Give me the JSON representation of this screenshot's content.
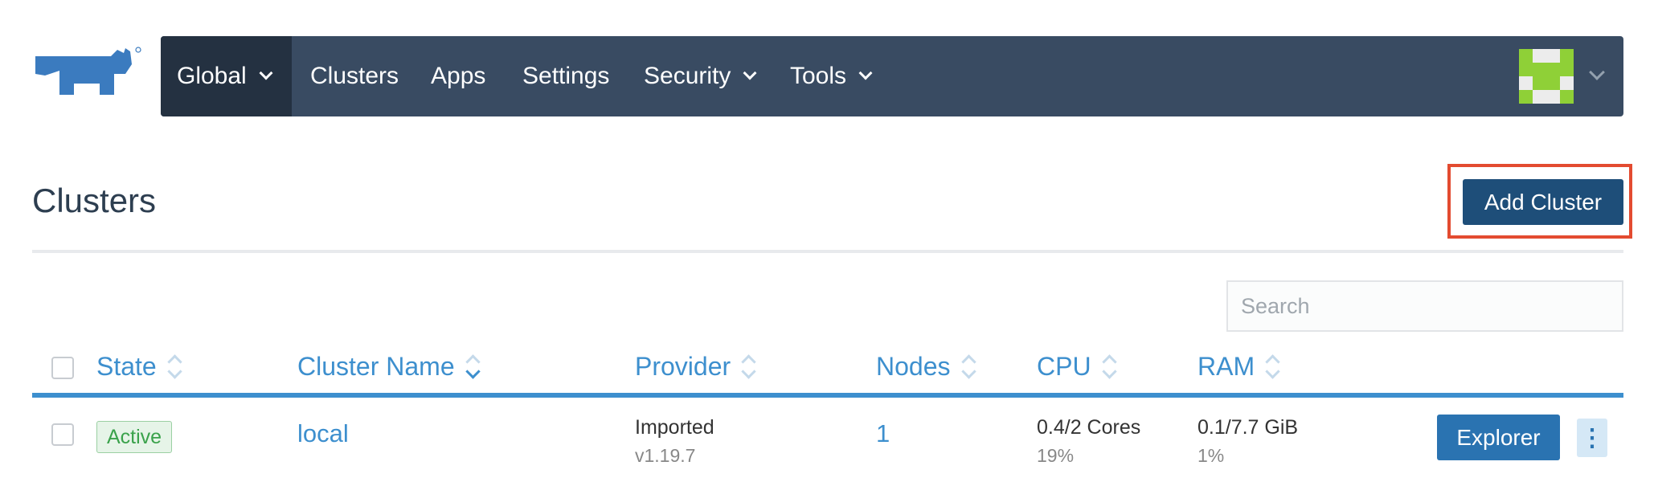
{
  "nav": {
    "global": "Global",
    "clusters": "Clusters",
    "apps": "Apps",
    "settings": "Settings",
    "security": "Security",
    "tools": "Tools"
  },
  "page": {
    "title": "Clusters",
    "add_button": "Add Cluster",
    "search_placeholder": "Search"
  },
  "table": {
    "columns": {
      "state": "State",
      "cluster_name": "Cluster Name",
      "provider": "Provider",
      "nodes": "Nodes",
      "cpu": "CPU",
      "ram": "RAM"
    },
    "rows": [
      {
        "state": "Active",
        "name": "local",
        "provider": "Imported",
        "provider_version": "v1.19.7",
        "nodes": "1",
        "cpu": "0.4/2 Cores",
        "cpu_pct": "19%",
        "ram": "0.1/7.7 GiB",
        "ram_pct": "1%",
        "action": "Explorer"
      }
    ]
  },
  "colors": {
    "navbar": "#394b62",
    "accent": "#3d8fce",
    "primary_button": "#1e4e79",
    "highlight": "#e34b30"
  },
  "icons": {
    "logo": "rancher-logo",
    "avatar": "user-identicon",
    "more": "kebab-menu-icon"
  }
}
